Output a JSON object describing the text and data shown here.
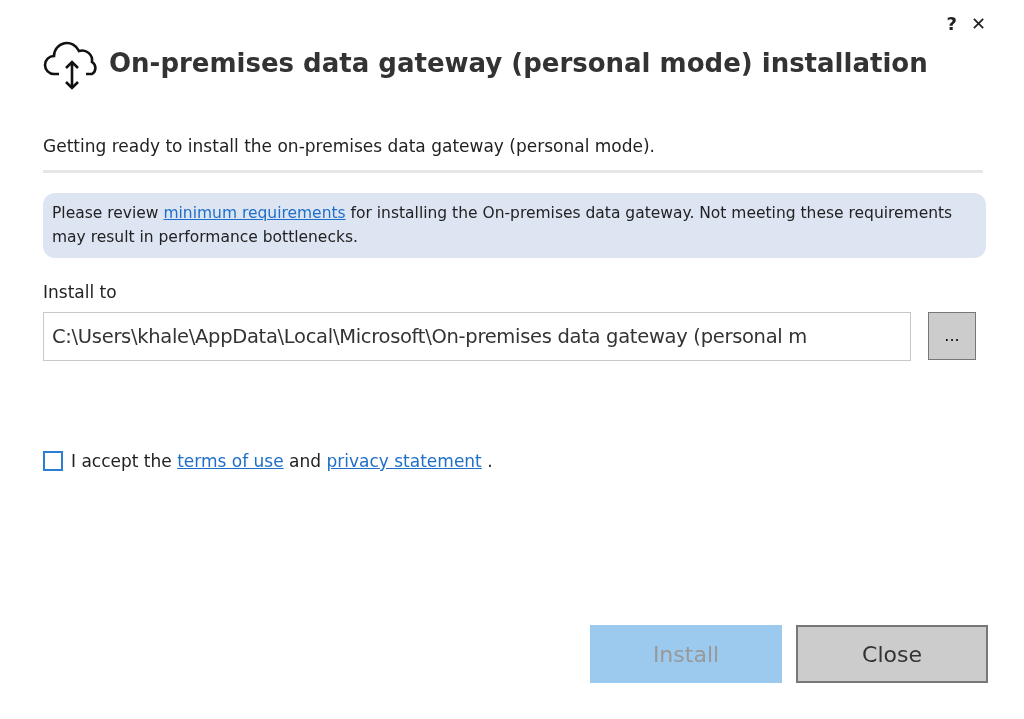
{
  "window": {
    "title": "On-premises data gateway (personal mode) installation",
    "help_label": "?",
    "close_label": "✕"
  },
  "subtitle": "Getting ready to install the on-premises data gateway (personal mode).",
  "notice": {
    "before": "Please review ",
    "link": "minimum requirements",
    "after": " for installing the On-premises data gateway. Not meeting these requirements may result in performance bottlenecks."
  },
  "install_to": {
    "label": "Install to",
    "value": "C:\\Users\\khale\\AppData\\Local\\Microsoft\\On-premises data gateway (personal m",
    "browse": "..."
  },
  "accept": {
    "checked": false,
    "before": "I accept the ",
    "link1": "terms of use",
    "middle": " and ",
    "link2": "privacy statement",
    "after": " ."
  },
  "buttons": [
    {
      "label": "Install",
      "kind": "primary",
      "disabled": true
    },
    {
      "label": "Close",
      "kind": "secondary",
      "disabled": false
    }
  ]
}
